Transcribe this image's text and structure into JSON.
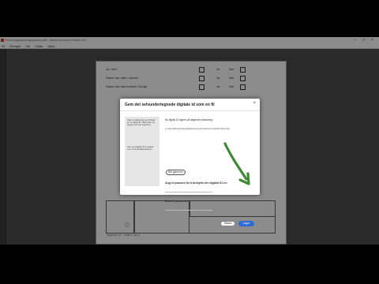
{
  "window": {
    "title": "Personopplysningsskjema.pdf - Adobe Acrobat Reader DC"
  },
  "menu": {
    "items": [
      "Fil",
      "Rediger",
      "Vis",
      "Vindu",
      "Hjelp"
    ]
  },
  "document": {
    "rows": [
      {
        "label": "Ja / Nei"
      },
      {
        "label": "Søker har vært i arbeid"
      },
      {
        "label": "Søker har fast bosted i Norge"
      }
    ],
    "col_labels": [
      "Ja",
      "Nei"
    ],
    "footer": "Skjema 11 - Side 2 av 2"
  },
  "dialog": {
    "title": "Gem det selvundertegnede digitale id som en fil",
    "close": "×",
    "side_paragraph_1": "Velg en plassering og et filnavn for ny digital ID. Passordet må oppgis ved hver signering.",
    "side_paragraph_2": "Den nye digitale ID-en lagres som en fil på datamaskinen.",
    "intro": "Ny digital ID lagres på følgende plassering:",
    "path": "C:\\Users\\Bruker\\AppData\\Roaming\\Adobe\\Acrobat\\DC\\Security\\",
    "browse_label": "Bla gjennom",
    "password_label": "Angi et passord for å beskytte den digitale ID-en:",
    "confirm_label": "Bekreft passordet:",
    "cancel_label": "Tilbake",
    "next_label": "Lagre"
  },
  "colors": {
    "accent": "#2c6bd3",
    "arrow": "#3e8a35"
  }
}
